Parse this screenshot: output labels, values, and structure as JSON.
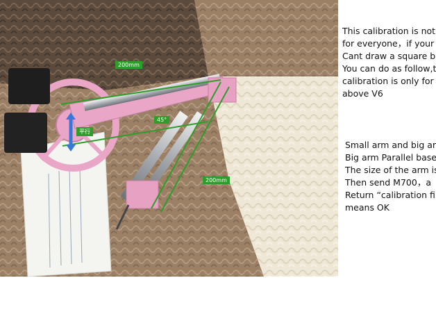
{
  "photo_labels": {
    "top_length": "200mm",
    "parallel": "平行",
    "angle": "45°",
    "right_length": "200mm"
  },
  "text_block_1": {
    "lines": [
      "This calibration is not",
      "for everyone，if your",
      "Cant draw a square b",
      "You can do as follow,t",
      "calibration is only for",
      "above V6"
    ]
  },
  "text_block_2": {
    "lines": [
      "Small arm and big ar",
      "Big arm Parallel base",
      "The size of the arm is",
      "Then send M700，a",
      "Return “calibration fi",
      "means OK"
    ]
  },
  "colors": {
    "label_green": "#2f9d2a",
    "robot_pink": "#e9a6c6",
    "mat_brown": "#9b8066",
    "mat_cream": "#efe8d6"
  }
}
